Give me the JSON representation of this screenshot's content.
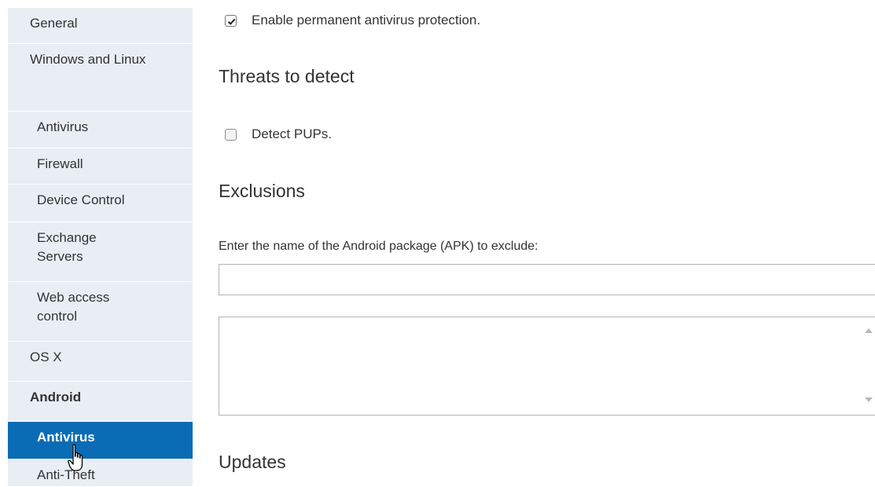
{
  "sidebar": {
    "items": [
      {
        "label": "General"
      },
      {
        "label": "Windows and Linux"
      },
      {
        "label": "Antivirus"
      },
      {
        "label": "Firewall"
      },
      {
        "label": "Device Control"
      },
      {
        "label": "Exchange Servers"
      },
      {
        "label": "Web access control"
      },
      {
        "label": "OS X"
      },
      {
        "label": "Android"
      },
      {
        "label": "Antivirus"
      },
      {
        "label": "Anti-Theft"
      }
    ],
    "active_color": "#0a6cb5",
    "background": "#e9eef4"
  },
  "main": {
    "permanent_protection": {
      "label": "Enable permanent antivirus protection.",
      "checked": true
    },
    "threats_title": "Threats to detect",
    "detect_pups": {
      "label": "Detect PUPs.",
      "checked": false
    },
    "exclusions_title": "Exclusions",
    "apk_label": "Enter the name of the Android package (APK) to exclude:",
    "apk_value": "",
    "updates_title": "Updates"
  }
}
